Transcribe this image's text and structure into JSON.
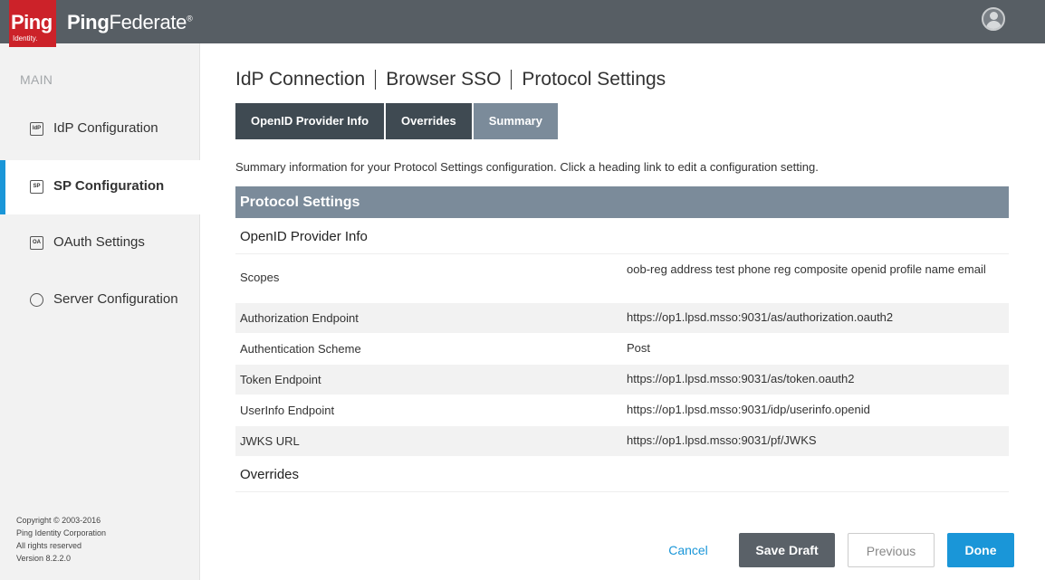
{
  "header": {
    "logo_ping": "Ping",
    "logo_identity": "Identity.",
    "brand_ping": "Ping",
    "brand_federate": "Federate",
    "brand_mark": "®"
  },
  "sidebar": {
    "section_label": "MAIN",
    "items": [
      {
        "label": "IdP Configuration",
        "icon_text": "IdP",
        "icon": "idp-icon"
      },
      {
        "label": "SP Configuration",
        "icon_text": "SP",
        "icon": "sp-icon",
        "active": true
      },
      {
        "label": "OAuth Settings",
        "icon_text": "OA",
        "icon": "oauth-icon"
      },
      {
        "label": "Server Configuration",
        "icon_text": "",
        "icon": "server-icon"
      }
    ],
    "footer": {
      "copyright": "Copyright © 2003-2016",
      "company": "Ping Identity Corporation",
      "rights": "All rights reserved",
      "version": "Version 8.2.2.0"
    }
  },
  "breadcrumb": [
    "IdP Connection",
    "Browser SSO",
    "Protocol Settings"
  ],
  "tabs": [
    {
      "label": "OpenID Provider Info"
    },
    {
      "label": "Overrides"
    },
    {
      "label": "Summary",
      "active": true
    }
  ],
  "intro": "Summary information for your Protocol Settings configuration. Click a heading link to edit a configuration setting.",
  "summary": {
    "section_title": "Protocol Settings",
    "group1_title": "OpenID Provider Info",
    "rows": [
      {
        "key": "Scopes",
        "value": "oob-reg address test phone reg composite openid profile name email"
      },
      {
        "key": "Authorization Endpoint",
        "value": "https://op1.lpsd.msso:9031/as/authorization.oauth2"
      },
      {
        "key": "Authentication Scheme",
        "value": "Post"
      },
      {
        "key": "Token Endpoint",
        "value": "https://op1.lpsd.msso:9031/as/token.oauth2"
      },
      {
        "key": "UserInfo Endpoint",
        "value": "https://op1.lpsd.msso:9031/idp/userinfo.openid"
      },
      {
        "key": "JWKS URL",
        "value": "https://op1.lpsd.msso:9031/pf/JWKS"
      }
    ],
    "group2_title": "Overrides"
  },
  "actions": {
    "cancel": "Cancel",
    "save_draft": "Save Draft",
    "previous": "Previous",
    "done": "Done"
  },
  "colors": {
    "header_bg": "#575e64",
    "logo_red": "#cc2229",
    "accent_blue": "#1a96d8",
    "tab_dark": "#3f4a52",
    "tab_active": "#7b8b9a"
  }
}
